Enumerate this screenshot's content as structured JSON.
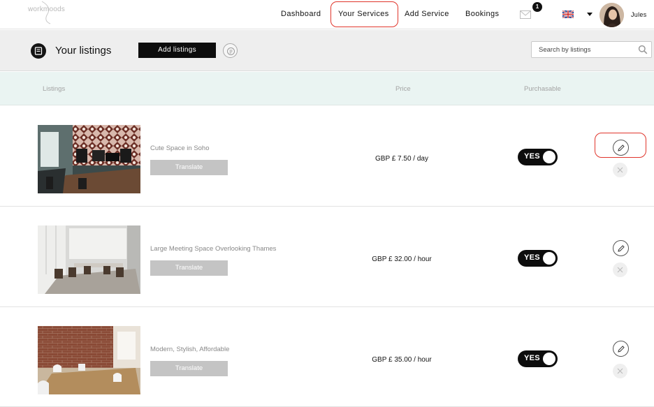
{
  "nav": {
    "logo_text": "workmoods",
    "links": {
      "dashboard": "Dashboard",
      "services": "Your Services",
      "add_service": "Add Service",
      "bookings": "Bookings"
    },
    "mail_count": "1",
    "user_name": "Jules",
    "language_icon": "uk-flag-icon"
  },
  "header": {
    "title": "Your listings",
    "add_button": "Add listings",
    "search_placeholder": "Search by listings"
  },
  "columns": {
    "listings": "Listings",
    "price": "Price",
    "purchasable": "Purchasable"
  },
  "rows": [
    {
      "title": "Cute Space in Soho",
      "translate": "Translate",
      "price": "GBP £ 7.50 / day",
      "purchasable": "YES"
    },
    {
      "title": "Large Meeting Space Overlooking Thames",
      "translate": "Translate",
      "price": "GBP £ 32.00 / hour",
      "purchasable": "YES"
    },
    {
      "title": "Modern, Stylish, Affordable",
      "translate": "Translate",
      "price": "GBP £ 35.00 / hour",
      "purchasable": "YES"
    }
  ],
  "colors": {
    "accent": "#0d0d0d",
    "highlight": "#e0352b",
    "column_header_bg": "#eaf4f2",
    "translate_bg": "#c4c4c4"
  }
}
